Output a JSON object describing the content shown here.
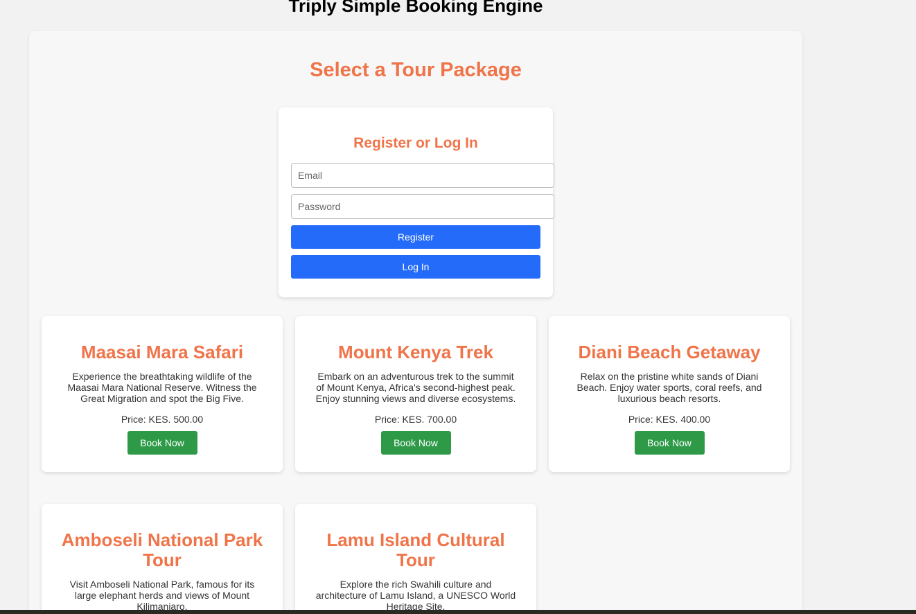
{
  "app": {
    "title": "Triply Simple Booking Engine"
  },
  "main": {
    "section_title": "Select a Tour Package"
  },
  "auth": {
    "title": "Register or Log In",
    "email_placeholder": "Email",
    "password_placeholder": "Password",
    "register_label": "Register",
    "login_label": "Log In"
  },
  "tours": [
    {
      "title": "Maasai Mara Safari",
      "description": "Experience the breathtaking wildlife of the Maasai Mara National Reserve. Witness the Great Migration and spot the Big Five.",
      "price": "Price: KES. 500.00",
      "button": "Book Now"
    },
    {
      "title": "Mount Kenya Trek",
      "description": "Embark on an adventurous trek to the summit of Mount Kenya, Africa's second-highest peak. Enjoy stunning views and diverse ecosystems.",
      "price": "Price: KES. 700.00",
      "button": "Book Now"
    },
    {
      "title": "Diani Beach Getaway",
      "description": "Relax on the pristine white sands of Diani Beach. Enjoy water sports, coral reefs, and luxurious beach resorts.",
      "price": "Price: KES. 400.00",
      "button": "Book Now"
    },
    {
      "title": "Amboseli National Park Tour",
      "description": "Visit Amboseli National Park, famous for its large elephant herds and views of Mount Kilimanjaro."
    },
    {
      "title": "Lamu Island Cultural Tour",
      "description": "Explore the rich Swahili culture and architecture of Lamu Island, a UNESCO World Heritage Site."
    }
  ],
  "colors": {
    "accent": "#f07449",
    "primary_button": "#246bfa",
    "book_button": "#2e9a48",
    "background": "#f2f2f2"
  }
}
